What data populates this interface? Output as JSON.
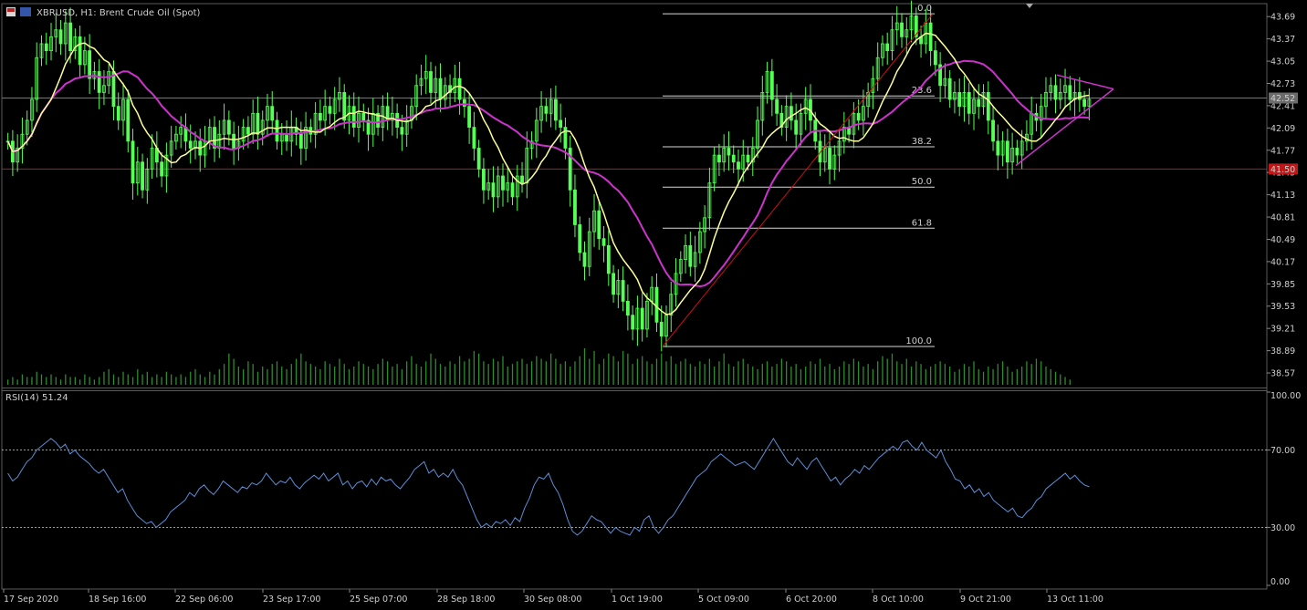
{
  "window": {
    "symbol_title": "XBRUSD, H1:  Brent Crude Oil (Spot)"
  },
  "colors": {
    "background": "#000000",
    "candles": "#55ff55",
    "ma_fast": "#ffff99",
    "ma_slow": "#cc33cc",
    "trendline": "#cc1111",
    "triangle": "#cc33cc",
    "support_line": "#aa2020",
    "bid_line": "#777777",
    "volume": "#2e8b2e",
    "rsi_line": "#5b8ed6",
    "grid": "#444444"
  },
  "chart_data": [
    {
      "type": "line",
      "description_kind": "candlestick price chart",
      "symbol": "XBRUSD",
      "timeframe": "H1",
      "instrument": "Brent Crude Oil (Spot)",
      "ylim": [
        38.4,
        43.85
      ],
      "y_tick_labels": [
        "43.69",
        "43.37",
        "43.05",
        "42.73",
        "42.41",
        "42.09",
        "41.77",
        "41.45",
        "41.13",
        "40.81",
        "40.49",
        "40.17",
        "39.85",
        "39.53",
        "39.21",
        "38.89",
        "38.57"
      ],
      "x_tick_labels": [
        "17 Sep 2020",
        "18 Sep 16:00",
        "22 Sep 06:00",
        "23 Sep 17:00",
        "25 Sep 07:00",
        "28 Sep 18:00",
        "30 Sep 08:00",
        "1 Oct 19:00",
        "5 Oct 09:00",
        "6 Oct 20:00",
        "8 Oct 10:00",
        "9 Oct 21:00",
        "13 Oct 11:00"
      ],
      "current_price_label": "42.52",
      "support_level_label": "41.50",
      "support_level": 41.5,
      "current_price": 42.52,
      "fibonacci": {
        "levels": [
          {
            "label": "0.0",
            "price": 43.73
          },
          {
            "label": "23.6",
            "price": 42.55
          },
          {
            "label": "38.2",
            "price": 41.82
          },
          {
            "label": "50.0",
            "price": 41.24
          },
          {
            "label": "61.8",
            "price": 40.65
          },
          {
            "label": "100.0",
            "price": 38.95
          }
        ]
      },
      "series": [
        {
          "values": [
            41.9,
            41.6,
            41.8,
            42.0,
            42.2,
            42.5,
            43.1,
            43.3,
            43.2,
            43.4,
            43.5,
            43.3,
            43.6,
            43.2,
            43.4,
            43.0,
            43.2,
            42.8,
            42.9,
            42.6,
            42.7,
            42.9,
            42.4,
            42.2,
            42.5,
            41.9,
            41.3,
            41.6,
            41.2,
            41.5,
            41.8,
            41.6,
            41.4,
            41.7,
            41.9,
            42.0,
            42.1,
            41.9,
            41.8,
            41.9,
            41.7,
            41.9,
            42.1,
            41.8,
            42.0,
            42.2,
            42.0,
            41.8,
            41.9,
            42.1,
            42.0,
            42.3,
            42.0,
            42.2,
            42.4,
            42.2,
            41.9,
            42.0,
            41.9,
            42.1,
            42.0,
            41.8,
            42.1,
            42.0,
            42.3,
            42.2,
            42.4,
            42.3,
            42.5,
            42.6,
            42.2,
            42.4,
            42.1,
            42.3,
            42.2,
            42.0,
            42.3,
            42.1,
            42.4,
            42.2,
            42.3,
            42.1,
            42.0,
            42.2,
            42.4,
            42.7,
            42.8,
            42.9,
            42.6,
            42.8,
            42.5,
            42.7,
            42.6,
            42.8,
            42.5,
            42.4,
            42.1,
            41.8,
            41.5,
            41.2,
            41.3,
            41.1,
            41.4,
            41.2,
            41.3,
            41.1,
            41.4,
            41.3,
            41.8,
            41.9,
            42.2,
            42.4,
            42.3,
            42.5,
            42.2,
            42.1,
            41.8,
            41.2,
            40.7,
            40.3,
            40.1,
            40.6,
            40.9,
            40.5,
            40.4,
            40.0,
            39.7,
            39.9,
            39.6,
            39.4,
            39.2,
            39.5,
            39.2,
            39.6,
            39.8,
            39.3,
            39.1,
            39.4,
            39.7,
            40.0,
            40.2,
            40.4,
            40.1,
            40.3,
            40.6,
            40.8,
            41.3,
            41.7,
            41.6,
            41.8,
            41.7,
            41.6,
            41.5,
            41.7,
            41.6,
            41.8,
            42.2,
            42.6,
            42.9,
            42.5,
            42.3,
            42.1,
            42.4,
            42.2,
            42.0,
            42.3,
            42.5,
            42.2,
            41.9,
            41.6,
            41.8,
            41.5,
            41.7,
            41.9,
            42.1,
            42.0,
            42.3,
            42.2,
            42.4,
            42.6,
            42.8,
            43.1,
            43.3,
            43.2,
            43.5,
            43.6,
            43.4,
            43.5,
            43.7,
            43.4,
            43.3,
            43.6,
            43.2,
            43.0,
            42.7,
            42.8,
            42.5,
            42.6,
            42.4,
            42.6,
            42.3,
            42.5,
            42.4,
            42.6,
            42.2,
            41.9,
            41.7,
            41.9,
            41.6,
            41.8,
            41.7,
            41.9,
            42.0,
            42.3,
            42.2,
            42.4,
            42.6,
            42.7,
            42.5,
            42.6,
            42.7,
            42.5,
            42.6,
            42.5,
            42.4,
            42.5
          ],
          "name": ""
        }
      ],
      "volume": [
        2,
        3,
        2,
        4,
        3,
        3,
        5,
        4,
        3,
        4,
        3,
        2,
        4,
        3,
        3,
        2,
        4,
        3,
        2,
        3,
        5,
        6,
        4,
        3,
        5,
        4,
        3,
        6,
        4,
        5,
        3,
        4,
        3,
        5,
        4,
        3,
        4,
        3,
        5,
        6,
        4,
        3,
        5,
        4,
        6,
        8,
        12,
        10,
        7,
        6,
        9,
        8,
        5,
        7,
        6,
        8,
        9,
        7,
        6,
        8,
        10,
        12,
        9,
        8,
        7,
        6,
        9,
        8,
        7,
        10,
        8,
        6,
        7,
        9,
        8,
        7,
        6,
        8,
        10,
        9,
        7,
        8,
        6,
        9,
        11,
        8,
        7,
        9,
        12,
        10,
        8,
        7,
        9,
        8,
        11,
        9,
        10,
        13,
        12,
        9,
        8,
        10,
        9,
        11,
        7,
        8,
        9,
        10,
        8,
        9,
        11,
        10,
        9,
        12,
        10,
        8,
        9,
        7,
        9,
        11,
        14,
        10,
        13,
        8,
        10,
        12,
        11,
        9,
        13,
        12,
        8,
        10,
        11,
        9,
        8,
        10,
        12,
        9,
        11,
        8,
        9,
        10,
        8,
        7,
        9,
        8,
        10,
        7,
        9,
        12,
        8,
        7,
        9,
        10,
        8,
        7,
        6,
        8,
        9,
        7,
        8,
        10,
        9,
        7,
        8,
        6,
        7,
        9,
        8,
        10,
        7,
        8,
        6,
        7,
        9,
        8,
        10,
        9,
        7,
        8,
        6,
        9,
        11,
        10,
        12,
        9,
        8,
        10,
        7,
        9,
        8,
        6,
        7,
        8,
        9,
        8,
        7,
        5,
        6,
        8,
        7,
        9,
        6,
        5,
        7,
        6,
        8,
        9,
        7,
        5,
        6,
        7,
        9,
        8,
        10,
        9,
        7,
        6,
        5,
        4,
        3,
        2
      ],
      "ma_fast_name": "",
      "ma_slow_name": ""
    },
    {
      "type": "line",
      "title": "RSI(14) 51.24",
      "indicator_label": "RSI(14) 51.24",
      "ylim": [
        0,
        100
      ],
      "y_tick_labels": [
        "100.00",
        "70.00",
        "30.00",
        "0.00"
      ],
      "levels": [
        70,
        30
      ],
      "series": [
        {
          "name": "",
          "values": [
            58,
            54,
            56,
            60,
            64,
            66,
            70,
            72,
            74,
            76,
            74,
            71,
            73,
            68,
            70,
            67,
            65,
            63,
            60,
            58,
            60,
            56,
            52,
            48,
            50,
            44,
            40,
            36,
            34,
            32,
            33,
            30,
            32,
            34,
            38,
            40,
            42,
            44,
            48,
            46,
            50,
            52,
            49,
            47,
            50,
            54,
            52,
            50,
            48,
            51,
            50,
            53,
            52,
            54,
            58,
            55,
            52,
            54,
            53,
            56,
            52,
            50,
            53,
            55,
            57,
            55,
            58,
            54,
            56,
            58,
            52,
            54,
            50,
            53,
            54,
            51,
            55,
            52,
            56,
            54,
            55,
            52,
            50,
            53,
            56,
            60,
            62,
            64,
            58,
            60,
            56,
            58,
            56,
            60,
            55,
            52,
            46,
            40,
            34,
            30,
            32,
            30,
            33,
            32,
            34,
            31,
            35,
            33,
            40,
            45,
            52,
            56,
            55,
            58,
            52,
            48,
            42,
            34,
            28,
            26,
            28,
            32,
            36,
            34,
            33,
            30,
            27,
            30,
            28,
            27,
            26,
            30,
            28,
            34,
            36,
            30,
            27,
            30,
            34,
            36,
            40,
            44,
            48,
            52,
            56,
            58,
            60,
            64,
            66,
            68,
            66,
            64,
            62,
            63,
            64,
            62,
            60,
            64,
            68,
            72,
            76,
            72,
            68,
            64,
            62,
            66,
            63,
            60,
            64,
            66,
            62,
            58,
            54,
            56,
            52,
            55,
            57,
            60,
            58,
            62,
            60,
            63,
            66,
            68,
            70,
            72,
            70,
            74,
            75,
            72,
            70,
            74,
            70,
            68,
            66,
            70,
            64,
            60,
            55,
            54,
            50,
            52,
            48,
            50,
            46,
            48,
            44,
            42,
            40,
            38,
            40,
            36,
            35,
            38,
            40,
            44,
            46,
            50,
            52,
            54,
            56,
            58,
            55,
            57,
            54,
            52,
            51
          ]
        }
      ]
    }
  ]
}
